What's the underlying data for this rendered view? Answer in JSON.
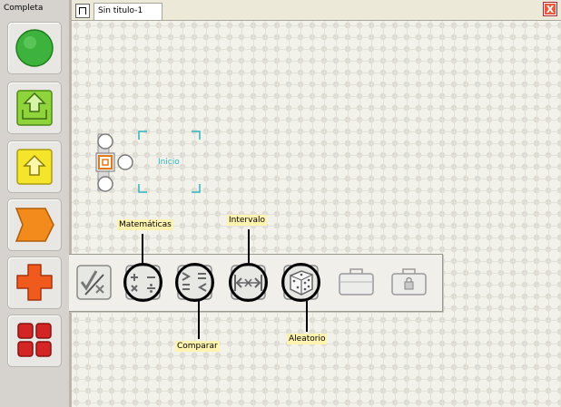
{
  "sidebar": {
    "title": "Completa"
  },
  "document": {
    "tab_label": "Sin titulo-1"
  },
  "canvas": {
    "start_label": "Inicio"
  },
  "palette": {
    "items": [
      "math-tools",
      "matematicas",
      "comparar",
      "intervalo",
      "aleatorio",
      "toolbox-empty",
      "toolbox-locked"
    ]
  },
  "callouts": {
    "matematicas": "Matemáticas",
    "intervalo": "Intervalo",
    "comparar": "Comparar",
    "aleatorio": "Aleatorio"
  },
  "window": {
    "close_label": "X"
  },
  "colors": {
    "green": "#3db33d",
    "lime": "#8ed43a",
    "yellow": "#f5e52a",
    "orange": "#f38a1c",
    "red_orange": "#f05a1c",
    "red": "#d42525",
    "cyan": "#2db6c0"
  }
}
